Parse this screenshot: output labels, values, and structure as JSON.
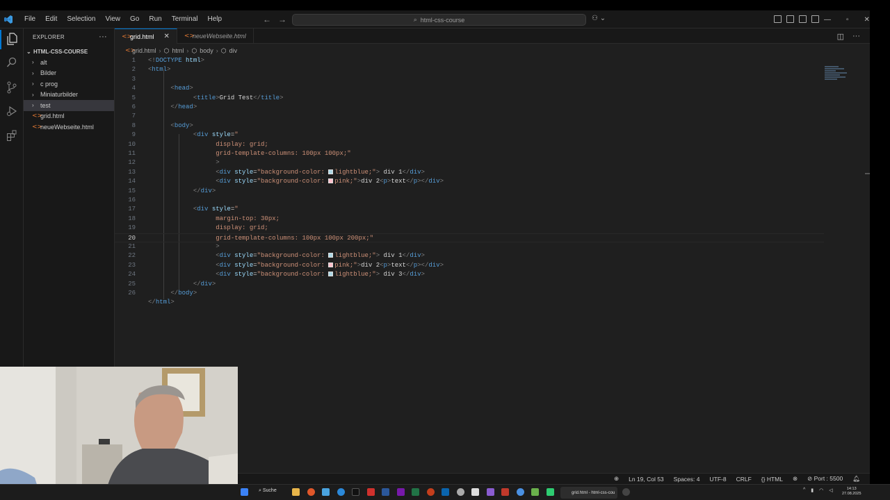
{
  "menu": [
    "File",
    "Edit",
    "Selection",
    "View",
    "Go",
    "Run",
    "Terminal",
    "Help"
  ],
  "command_center": {
    "text": "html-css-course"
  },
  "explorer": {
    "title": "EXPLORER",
    "project": "HTML-CSS-COURSE",
    "items": [
      {
        "label": "alt",
        "type": "folder"
      },
      {
        "label": "Bilder",
        "type": "folder"
      },
      {
        "label": "c prog",
        "type": "folder"
      },
      {
        "label": "Miniaturbilder",
        "type": "folder"
      },
      {
        "label": "test",
        "type": "folder",
        "selected": true
      },
      {
        "label": "grid.html",
        "type": "file"
      },
      {
        "label": "neueWebseite.html",
        "type": "file"
      }
    ]
  },
  "tabs": [
    {
      "label": "grid.html",
      "active": true
    },
    {
      "label": "neueWebseite.html",
      "active": false
    }
  ],
  "breadcrumb": [
    "grid.html",
    "html",
    "body",
    "div"
  ],
  "editor": {
    "current_line": 19,
    "line_numbers": [
      "1",
      "2",
      "3",
      "4",
      "5",
      "6",
      "7",
      "8",
      "9",
      "10",
      "11",
      "12",
      "13",
      "14",
      "15",
      "16",
      "17",
      "18",
      "19",
      "20",
      "21",
      "22",
      "23",
      "24",
      "25",
      "26"
    ]
  },
  "status": {
    "position": "Ln 19, Col 53",
    "spaces": "Spaces: 4",
    "encoding": "UTF-8",
    "eol": "CRLF",
    "language": "HTML",
    "port": "Port : 5500"
  },
  "taskbar": {
    "search_label": "Suche",
    "active_window": "grid.html - html-css-cou",
    "time": "14:13",
    "date": "27.08.2025"
  },
  "colors": {
    "accent": "#0078d4",
    "editor_bg": "#1f1f1f",
    "sidebar_bg": "#181818",
    "tag": "#569cd6",
    "attr": "#9cdcfe",
    "string": "#ce9178"
  }
}
